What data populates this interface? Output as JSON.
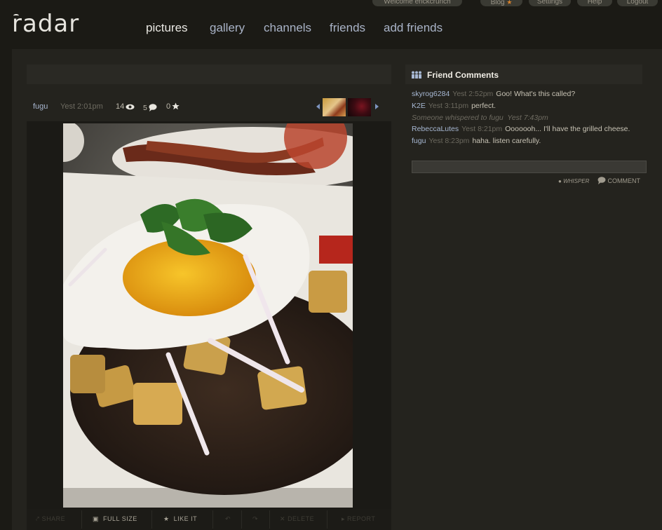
{
  "topbar": {
    "welcome": "Welcome erickcrunch",
    "blog": "Blog",
    "settings": "Settings",
    "help": "Help",
    "logout": "Logout"
  },
  "logo": "radar",
  "nav": [
    "pictures",
    "gallery",
    "channels",
    "friends",
    "add friends"
  ],
  "photo": {
    "owner": "fugu",
    "time": "Yest 2:01pm",
    "views": "14",
    "comments": "5",
    "likes": "0"
  },
  "actions": {
    "share": "SHARE",
    "full_size": "FULL SIZE",
    "like_it": "LIKE IT",
    "delete": "DELETE",
    "report": "REPORT"
  },
  "friend_comments": {
    "title": "Friend Comments",
    "items": [
      {
        "user": "skyrog6284",
        "time": "Yest 2:52pm",
        "text": "Goo! What's this called?"
      },
      {
        "user": "K2E",
        "time": "Yest 3:11pm",
        "text": "perfect."
      },
      {
        "whisper": "Someone whispered to fugu",
        "time": "Yest 7:43pm"
      },
      {
        "user": "RebeccaLutes",
        "time": "Yest 8:21pm",
        "text": "Ooooooh... I'll have the grilled cheese."
      },
      {
        "user": "fugu",
        "time": "Yest 8:23pm",
        "text": "haha. listen carefully."
      }
    ],
    "whisper_button": "WHISPER",
    "comment_button": "COMMENT"
  },
  "colors": {
    "background": "#1b1a15",
    "panel": "#24231e",
    "link": "#a7b8d3",
    "accent": "#d9822b"
  }
}
